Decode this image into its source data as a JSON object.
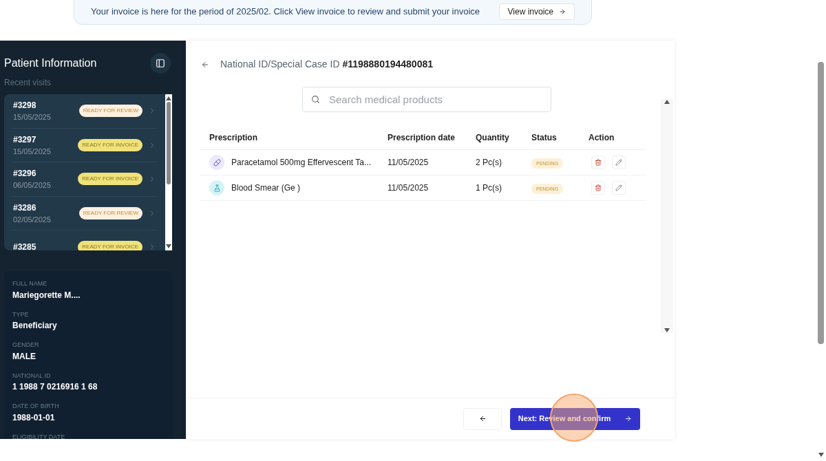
{
  "banner": {
    "message": "Your invoice is here for the period of 2025/02. Click View invoice to review and submit your invoice",
    "button": "View invoice"
  },
  "sidebar": {
    "title": "Patient Information",
    "subtitle": "Recent visits",
    "visits": [
      {
        "id": "#3298",
        "date": "15/05/2025",
        "status": "READY FOR REVIEW",
        "kind": "review"
      },
      {
        "id": "#3297",
        "date": "15/05/2025",
        "status": "READY FOR INVOICE",
        "kind": "invoice"
      },
      {
        "id": "#3296",
        "date": "06/05/2025",
        "status": "READY FOR INVOICE",
        "kind": "invoice"
      },
      {
        "id": "#3286",
        "date": "02/05/2025",
        "status": "READY FOR REVIEW",
        "kind": "review"
      },
      {
        "id": "#3285",
        "status": "READY FOR INVOICE",
        "kind": "invoice"
      }
    ],
    "fields": [
      {
        "label": "FULL NAME",
        "value": "Mariegorette M...."
      },
      {
        "label": "TYPE",
        "value": "Beneficiary"
      },
      {
        "label": "GENDER",
        "value": "MALE"
      },
      {
        "label": "NATIONAL ID",
        "value": "1 1988 7 0216916 1 68"
      },
      {
        "label": "DATE OF BIRTH",
        "value": "1988-01-01"
      },
      {
        "label": "ELIGIBILITY DATE"
      }
    ]
  },
  "main": {
    "heading": "National ID/Special Case ID",
    "case_id": "#1198880194480081",
    "search": {
      "placeholder": "Search medical products"
    },
    "table": {
      "columns": [
        "Prescription",
        "Prescription date",
        "Quantity",
        "Status",
        "Action"
      ],
      "rows": [
        {
          "kind": "pill",
          "name": "Paracetamol 500mg Effervescent Ta...",
          "date": "11/05/2025",
          "quantity": "2 Pc(s)",
          "status": "PENDING"
        },
        {
          "kind": "lab",
          "name": "Blood Smear (Ge )",
          "date": "11/05/2025",
          "quantity": "1 Pc(s)",
          "status": "PENDING"
        }
      ]
    },
    "next_button": "Next: Review and confirm"
  }
}
